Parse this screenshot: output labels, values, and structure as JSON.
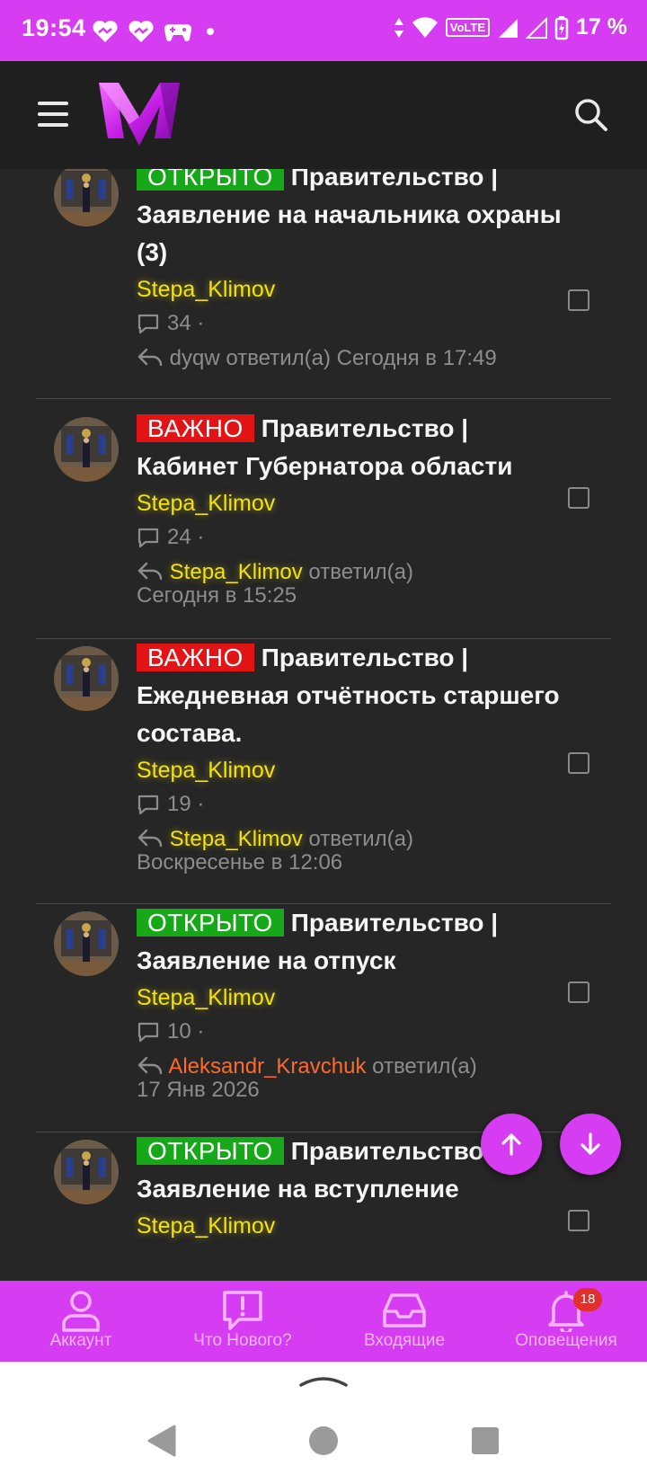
{
  "status_bar": {
    "time": "19:54",
    "volte": "VoLTE",
    "battery": "17 %"
  },
  "feed": [
    {
      "badge": "ОТКРЫТО",
      "badge_color": "#17a819",
      "title": "Правительство | Заявление на начальника охраны (3)",
      "author": "Stepa_Klimov",
      "replies": "34 ·",
      "last_user": "dyqw",
      "last_user_color": "gray",
      "replied_text": "ответил(а)",
      "last_time": "Сегодня в 17:49"
    },
    {
      "badge": "ВАЖНО",
      "badge_color": "#e21416",
      "title": "Правительство | Кабинет Губернатора области",
      "author": "Stepa_Klimov",
      "replies": "24 ·",
      "last_user": "Stepa_Klimov",
      "last_user_color": "yellow",
      "replied_text": "ответил(а)",
      "last_time": "Сегодня в 15:25"
    },
    {
      "badge": "ВАЖНО",
      "badge_color": "#e21416",
      "title": "Правительство | Ежедневная отчётность старшего состава.",
      "author": "Stepa_Klimov",
      "replies": "19 ·",
      "last_user": "Stepa_Klimov",
      "last_user_color": "yellow",
      "replied_text": "ответил(а)",
      "last_time": "Воскресенье в 12:06"
    },
    {
      "badge": "ОТКРЫТО",
      "badge_color": "#17a819",
      "title": "Правительство | Заявление на отпуск",
      "author": "Stepa_Klimov",
      "replies": "10 ·",
      "last_user": "Aleksandr_Kravchuk",
      "last_user_color": "orange",
      "replied_text": "ответил(а)",
      "last_time": "17 Янв 2026"
    },
    {
      "badge": "ОТКРЫТО",
      "badge_color": "#17a819",
      "title": "Правительство | Заявление на вступление",
      "author": "Stepa_Klimov"
    }
  ],
  "bottom_nav": [
    {
      "label": "Аккаунт",
      "icon": "user-icon"
    },
    {
      "label": "Что Нового?",
      "icon": "whats-new-icon"
    },
    {
      "label": "Входящие",
      "icon": "inbox-icon"
    },
    {
      "label": "Оповещения",
      "icon": "bell-icon",
      "badge": "18"
    }
  ],
  "fabs": {
    "up": "arrow-up-icon",
    "down": "arrow-down-icon"
  }
}
